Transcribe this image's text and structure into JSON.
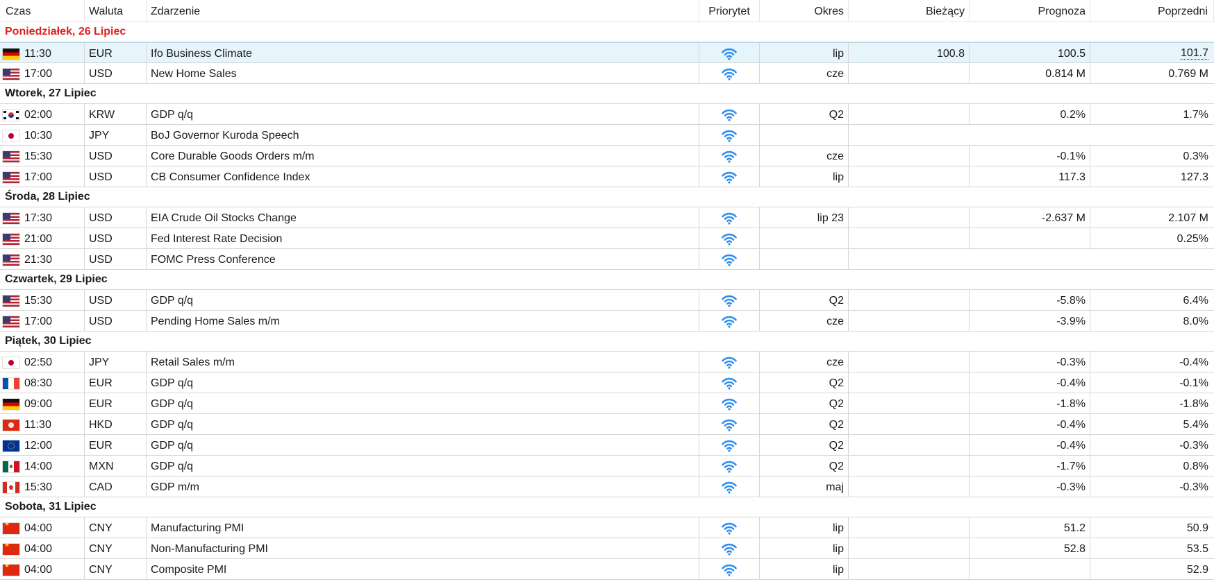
{
  "header": {
    "time": "Czas",
    "currency": "Waluta",
    "event": "Zdarzenie",
    "priority": "Priorytet",
    "period": "Okres",
    "actual": "Bieżący",
    "forecast": "Prognoza",
    "previous": "Poprzedni"
  },
  "colors": {
    "today_heading": "#e0201f",
    "priority_icon": "#2f8ff0",
    "selected_row": "#e6f4fb"
  },
  "days": [
    {
      "label": "Poniedziałek, 26 Lipiec",
      "today": true,
      "events": [
        {
          "flag": "de",
          "time": "11:30",
          "currency": "EUR",
          "name": "Ifo Business Climate",
          "priority_icon": "wifi-icon",
          "period": "lip",
          "actual": "100.8",
          "forecast": "100.5",
          "previous": "101.7",
          "selected": true,
          "previous_revised": true
        },
        {
          "flag": "us",
          "time": "17:00",
          "currency": "USD",
          "name": "New Home Sales",
          "priority_icon": "wifi-icon",
          "period": "cze",
          "actual": "",
          "forecast": "0.814 M",
          "previous": "0.769 M"
        }
      ]
    },
    {
      "label": "Wtorek, 27 Lipiec",
      "events": [
        {
          "flag": "kr",
          "time": "02:00",
          "currency": "KRW",
          "name": "GDP q/q",
          "priority_icon": "wifi-icon",
          "period": "Q2",
          "actual": "",
          "forecast": "0.2%",
          "previous": "1.7%"
        },
        {
          "flag": "jp",
          "time": "10:30",
          "currency": "JPY",
          "name": "BoJ Governor Kuroda Speech",
          "priority_icon": "wifi-icon",
          "period": "",
          "actual": "",
          "forecast": "",
          "previous": "",
          "speech": true
        },
        {
          "flag": "us",
          "time": "15:30",
          "currency": "USD",
          "name": "Core Durable Goods Orders m/m",
          "priority_icon": "wifi-icon",
          "period": "cze",
          "actual": "",
          "forecast": "-0.1%",
          "previous": "0.3%"
        },
        {
          "flag": "us",
          "time": "17:00",
          "currency": "USD",
          "name": "CB Consumer Confidence Index",
          "priority_icon": "wifi-icon",
          "period": "lip",
          "actual": "",
          "forecast": "117.3",
          "previous": "127.3"
        }
      ]
    },
    {
      "label": "Środa, 28 Lipiec",
      "events": [
        {
          "flag": "us",
          "time": "17:30",
          "currency": "USD",
          "name": "EIA Crude Oil Stocks Change",
          "priority_icon": "wifi-icon",
          "period": "lip 23",
          "actual": "",
          "forecast": "-2.637 M",
          "previous": "2.107 M"
        },
        {
          "flag": "us",
          "time": "21:00",
          "currency": "USD",
          "name": "Fed Interest Rate Decision",
          "priority_icon": "wifi-icon",
          "period": "",
          "actual": "",
          "forecast": "",
          "previous": "0.25%"
        },
        {
          "flag": "us",
          "time": "21:30",
          "currency": "USD",
          "name": "FOMC Press Conference",
          "priority_icon": "wifi-icon",
          "period": "",
          "actual": "",
          "forecast": "",
          "previous": "",
          "speech": true
        }
      ]
    },
    {
      "label": "Czwartek, 29 Lipiec",
      "events": [
        {
          "flag": "us",
          "time": "15:30",
          "currency": "USD",
          "name": "GDP q/q",
          "priority_icon": "wifi-icon",
          "period": "Q2",
          "actual": "",
          "forecast": "-5.8%",
          "previous": "6.4%"
        },
        {
          "flag": "us",
          "time": "17:00",
          "currency": "USD",
          "name": "Pending Home Sales m/m",
          "priority_icon": "wifi-icon",
          "period": "cze",
          "actual": "",
          "forecast": "-3.9%",
          "previous": "8.0%"
        }
      ]
    },
    {
      "label": "Piątek, 30 Lipiec",
      "events": [
        {
          "flag": "jp",
          "time": "02:50",
          "currency": "JPY",
          "name": "Retail Sales m/m",
          "priority_icon": "wifi-icon",
          "period": "cze",
          "actual": "",
          "forecast": "-0.3%",
          "previous": "-0.4%"
        },
        {
          "flag": "fr",
          "time": "08:30",
          "currency": "EUR",
          "name": "GDP q/q",
          "priority_icon": "wifi-icon",
          "period": "Q2",
          "actual": "",
          "forecast": "-0.4%",
          "previous": "-0.1%"
        },
        {
          "flag": "de",
          "time": "09:00",
          "currency": "EUR",
          "name": "GDP q/q",
          "priority_icon": "wifi-icon",
          "period": "Q2",
          "actual": "",
          "forecast": "-1.8%",
          "previous": "-1.8%"
        },
        {
          "flag": "hk",
          "time": "11:30",
          "currency": "HKD",
          "name": "GDP q/q",
          "priority_icon": "wifi-icon",
          "period": "Q2",
          "actual": "",
          "forecast": "-0.4%",
          "previous": "5.4%"
        },
        {
          "flag": "eu",
          "time": "12:00",
          "currency": "EUR",
          "name": "GDP q/q",
          "priority_icon": "wifi-icon",
          "period": "Q2",
          "actual": "",
          "forecast": "-0.4%",
          "previous": "-0.3%"
        },
        {
          "flag": "mx",
          "time": "14:00",
          "currency": "MXN",
          "name": "GDP q/q",
          "priority_icon": "wifi-icon",
          "period": "Q2",
          "actual": "",
          "forecast": "-1.7%",
          "previous": "0.8%"
        },
        {
          "flag": "ca",
          "time": "15:30",
          "currency": "CAD",
          "name": "GDP m/m",
          "priority_icon": "wifi-icon",
          "period": "maj",
          "actual": "",
          "forecast": "-0.3%",
          "previous": "-0.3%"
        }
      ]
    },
    {
      "label": "Sobota, 31 Lipiec",
      "events": [
        {
          "flag": "cn",
          "time": "04:00",
          "currency": "CNY",
          "name": "Manufacturing PMI",
          "priority_icon": "wifi-icon",
          "period": "lip",
          "actual": "",
          "forecast": "51.2",
          "previous": "50.9"
        },
        {
          "flag": "cn",
          "time": "04:00",
          "currency": "CNY",
          "name": "Non-Manufacturing PMI",
          "priority_icon": "wifi-icon",
          "period": "lip",
          "actual": "",
          "forecast": "52.8",
          "previous": "53.5"
        },
        {
          "flag": "cn",
          "time": "04:00",
          "currency": "CNY",
          "name": "Composite PMI",
          "priority_icon": "wifi-icon",
          "period": "lip",
          "actual": "",
          "forecast": "",
          "previous": "52.9"
        }
      ]
    }
  ]
}
